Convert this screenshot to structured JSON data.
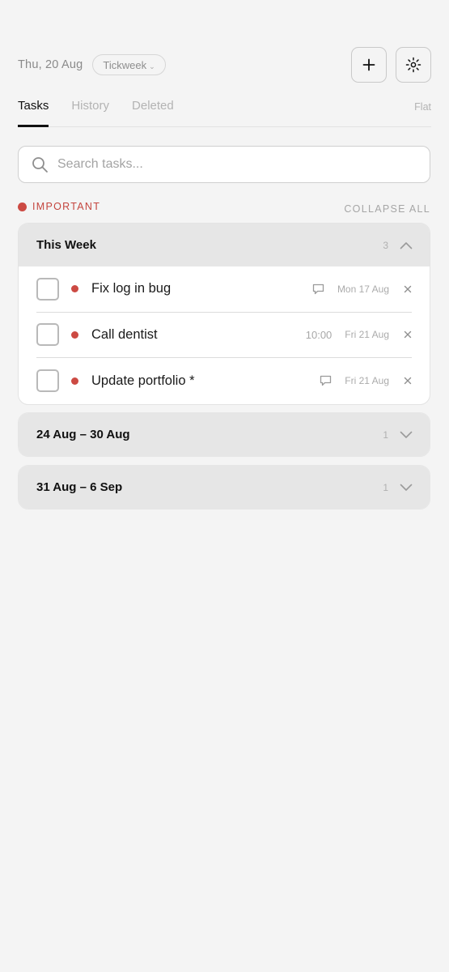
{
  "header": {
    "date": "Thu, 20 Aug",
    "workspace": "Tickweek",
    "add_icon": "plus-icon",
    "theme_icon": "sun-icon"
  },
  "tabs": [
    {
      "label": "Tasks",
      "active": true
    },
    {
      "label": "History",
      "active": false
    },
    {
      "label": "Deleted",
      "active": false
    }
  ],
  "view_toggle": "Flat",
  "search": {
    "placeholder": "Search tasks...",
    "value": ""
  },
  "filter": {
    "label": "IMPORTANT",
    "color": "#cc4a43"
  },
  "collapse_all": "COLLAPSE ALL",
  "groups": [
    {
      "title": "This Week",
      "count": "3",
      "expanded": true,
      "tasks": [
        {
          "title": "Fix log in bug",
          "has_comment": true,
          "time": "",
          "due": "Mon 17 Aug"
        },
        {
          "title": "Call dentist",
          "has_comment": false,
          "time": "10:00",
          "due": "Fri 21 Aug"
        },
        {
          "title": "Update portfolio *",
          "has_comment": true,
          "time": "",
          "due": "Fri 21 Aug"
        }
      ]
    },
    {
      "title": "24 Aug – 30 Aug",
      "count": "1",
      "expanded": false
    },
    {
      "title": "31 Aug – 6 Sep",
      "count": "1",
      "expanded": false
    }
  ]
}
